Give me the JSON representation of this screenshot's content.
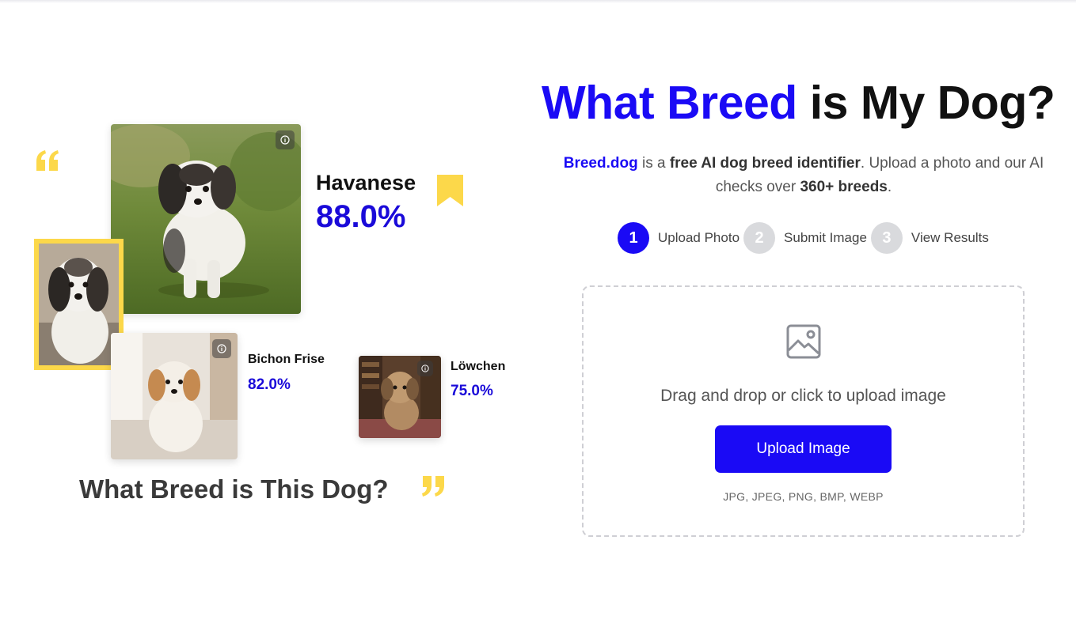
{
  "hero": {
    "title_accent": "What Breed",
    "title_rest": " is My Dog?",
    "desc_brand": "Breed.dog",
    "desc_part1": " is a ",
    "desc_bold1": "free AI dog breed identifier",
    "desc_part2": ". Upload a photo and our AI checks over ",
    "desc_bold2": "360+ breeds",
    "desc_part3": "."
  },
  "steps": [
    {
      "number": "1",
      "label": "Upload Photo",
      "active": true
    },
    {
      "number": "2",
      "label": "Submit Image",
      "active": false
    },
    {
      "number": "3",
      "label": "View Results",
      "active": false
    }
  ],
  "upload": {
    "prompt": "Drag and drop or click to upload image",
    "button_label": "Upload Image",
    "formats": "JPG, JPEG, PNG, BMP, WEBP"
  },
  "collage": {
    "results": [
      {
        "breed": "Havanese",
        "confidence": "88.0%"
      },
      {
        "breed": "Bichon Frise",
        "confidence": "82.0%"
      },
      {
        "breed": "Löwchen",
        "confidence": "75.0%"
      }
    ],
    "caption": "What Breed is This Dog?"
  },
  "colors": {
    "accent": "#1a0af5",
    "highlight": "#fcd84a",
    "step_inactive": "#d9dadd"
  }
}
